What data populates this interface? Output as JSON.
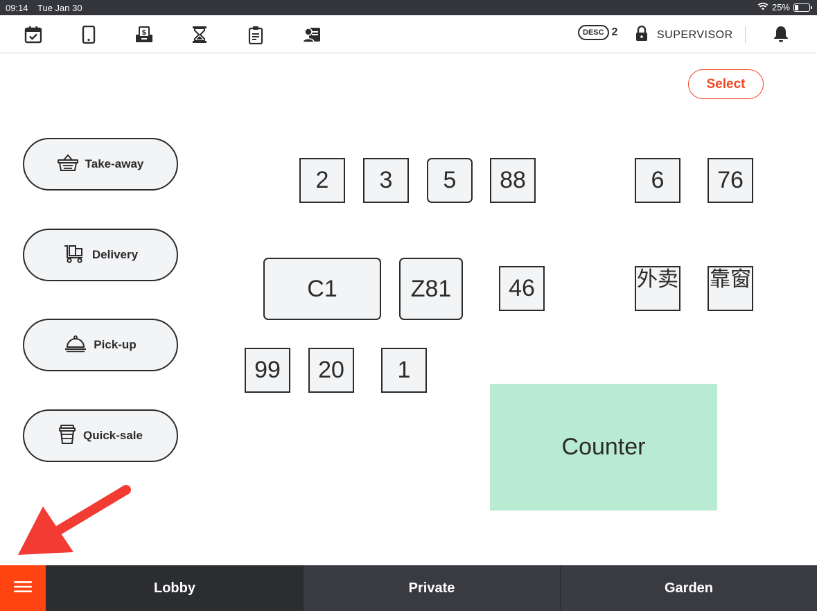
{
  "status_bar": {
    "time": "09:14",
    "date": "Tue Jan 30",
    "battery_text": "25%",
    "battery_level": 0.25
  },
  "toolbar": {
    "icons": [
      "calendar-check-icon",
      "tablet-icon",
      "cash-drawer-icon",
      "hourglass-icon",
      "clipboard-icon",
      "user-card-icon"
    ],
    "desc_label": "DESC",
    "desc_count": "2",
    "role": "SUPERVISOR"
  },
  "select_label": "Select",
  "order_types": [
    {
      "label": "Take-away",
      "icon": "basket-icon"
    },
    {
      "label": "Delivery",
      "icon": "delivery-cart-icon"
    },
    {
      "label": "Pick-up",
      "icon": "cloche-icon"
    },
    {
      "label": "Quick-sale",
      "icon": "cup-icon"
    }
  ],
  "tables": [
    {
      "label": "2"
    },
    {
      "label": "3"
    },
    {
      "label": "5"
    },
    {
      "label": "88"
    },
    {
      "label": "6"
    },
    {
      "label": "76"
    },
    {
      "label": "C1"
    },
    {
      "label": "Z81"
    },
    {
      "label": "46"
    },
    {
      "label": "外卖"
    },
    {
      "label": "靠窗"
    },
    {
      "label": "99"
    },
    {
      "label": "20"
    },
    {
      "label": "1"
    }
  ],
  "counter_label": "Counter",
  "areas": [
    {
      "label": "Lobby",
      "active": true
    },
    {
      "label": "Private",
      "active": false
    },
    {
      "label": "Garden",
      "active": false
    }
  ],
  "colors": {
    "accent": "#ff4411",
    "select_border": "#f04a24",
    "counter_fill": "#b9ebd3",
    "bottom_bar": "#3a3b40",
    "arrow": "#f23b33"
  }
}
